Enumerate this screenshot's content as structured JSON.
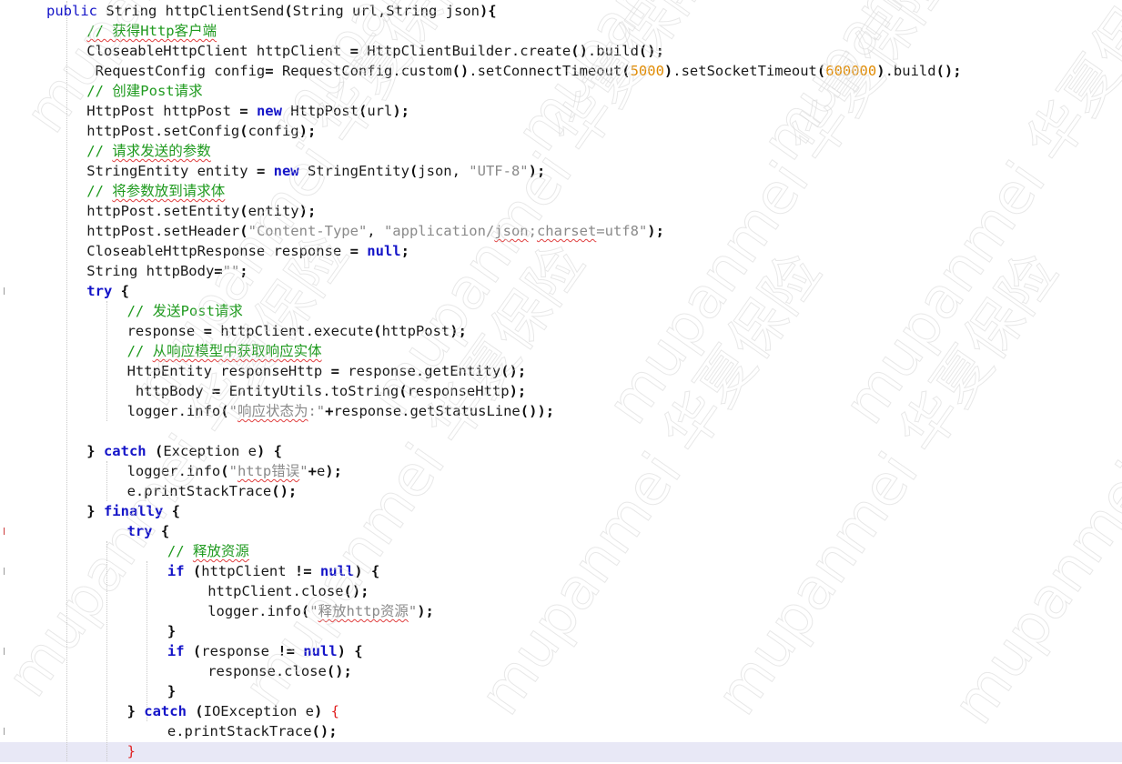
{
  "editor": {
    "watermark": "mupanmei 华夏保险",
    "gutter_marks": [
      {
        "line": 14,
        "kind": "normal"
      },
      {
        "line": 26,
        "kind": "error"
      },
      {
        "line": 28,
        "kind": "normal"
      },
      {
        "line": 32,
        "kind": "normal"
      },
      {
        "line": 36,
        "kind": "normal"
      }
    ],
    "lines": [
      {
        "indent": 1,
        "tokens": [
          {
            "t": "public",
            "c": "kwl"
          },
          {
            "t": " String httpClientSend",
            "c": "tx"
          },
          {
            "t": "(",
            "c": "pn"
          },
          {
            "t": "String url,String json",
            "c": "tx"
          },
          {
            "t": "){",
            "c": "pn"
          }
        ]
      },
      {
        "indent": 2,
        "tokens": [
          {
            "t": "// 获得Http客户端",
            "c": "cm",
            "sq": true
          }
        ]
      },
      {
        "indent": 2,
        "tokens": [
          {
            "t": "CloseableHttpClient httpClient ",
            "c": "tx"
          },
          {
            "t": "=",
            "c": "pn"
          },
          {
            "t": " HttpClientBuilder.create",
            "c": "tx"
          },
          {
            "t": "()",
            "c": "pn"
          },
          {
            "t": ".build",
            "c": "tx"
          },
          {
            "t": "();",
            "c": "pn"
          }
        ]
      },
      {
        "indent": 2,
        "tokens": [
          {
            "t": " RequestConfig config",
            "c": "tx"
          },
          {
            "t": "=",
            "c": "pn"
          },
          {
            "t": " RequestConfig.custom",
            "c": "tx"
          },
          {
            "t": "()",
            "c": "pn"
          },
          {
            "t": ".setConnectTimeout",
            "c": "tx"
          },
          {
            "t": "(",
            "c": "pn"
          },
          {
            "t": "5000",
            "c": "nm"
          },
          {
            "t": ")",
            "c": "pn"
          },
          {
            "t": ".setSocketTimeout",
            "c": "tx"
          },
          {
            "t": "(",
            "c": "pn"
          },
          {
            "t": "600000",
            "c": "nm"
          },
          {
            "t": ")",
            "c": "pn"
          },
          {
            "t": ".build",
            "c": "tx"
          },
          {
            "t": "();",
            "c": "pn"
          }
        ]
      },
      {
        "indent": 2,
        "tokens": [
          {
            "t": "// 创建Post请求",
            "c": "cm"
          }
        ]
      },
      {
        "indent": 2,
        "tokens": [
          {
            "t": "HttpPost httpPost ",
            "c": "tx"
          },
          {
            "t": "=",
            "c": "pn"
          },
          {
            "t": " ",
            "c": "tx"
          },
          {
            "t": "new",
            "c": "kw"
          },
          {
            "t": " HttpPost",
            "c": "tx"
          },
          {
            "t": "(",
            "c": "pn"
          },
          {
            "t": "url",
            "c": "tx"
          },
          {
            "t": ");",
            "c": "pn"
          }
        ]
      },
      {
        "indent": 2,
        "tokens": [
          {
            "t": "httpPost.setConfig",
            "c": "tx"
          },
          {
            "t": "(",
            "c": "pn"
          },
          {
            "t": "config",
            "c": "tx"
          },
          {
            "t": ");",
            "c": "pn"
          }
        ]
      },
      {
        "indent": 2,
        "tokens": [
          {
            "t": "// ",
            "c": "cm"
          },
          {
            "t": "请求发送的参数",
            "c": "cm",
            "sq": true
          }
        ]
      },
      {
        "indent": 2,
        "tokens": [
          {
            "t": "StringEntity entity ",
            "c": "tx"
          },
          {
            "t": "=",
            "c": "pn"
          },
          {
            "t": " ",
            "c": "tx"
          },
          {
            "t": "new",
            "c": "kw"
          },
          {
            "t": " StringEntity",
            "c": "tx"
          },
          {
            "t": "(",
            "c": "pn"
          },
          {
            "t": "json, ",
            "c": "tx"
          },
          {
            "t": "\"UTF-8\"",
            "c": "st"
          },
          {
            "t": ");",
            "c": "pn"
          }
        ]
      },
      {
        "indent": 2,
        "tokens": [
          {
            "t": "// ",
            "c": "cm"
          },
          {
            "t": "将参数放到请求体",
            "c": "cm",
            "sq": true
          }
        ]
      },
      {
        "indent": 2,
        "tokens": [
          {
            "t": "httpPost.setEntity",
            "c": "tx"
          },
          {
            "t": "(",
            "c": "pn"
          },
          {
            "t": "entity",
            "c": "tx"
          },
          {
            "t": ");",
            "c": "pn"
          }
        ]
      },
      {
        "indent": 2,
        "tokens": [
          {
            "t": "httpPost.setHeader",
            "c": "tx"
          },
          {
            "t": "(",
            "c": "pn"
          },
          {
            "t": "\"Content-Type\"",
            "c": "st"
          },
          {
            "t": ", ",
            "c": "tx"
          },
          {
            "t": "\"application/",
            "c": "st"
          },
          {
            "t": "json",
            "c": "st",
            "sq": true
          },
          {
            "t": ";",
            "c": "st"
          },
          {
            "t": "charset",
            "c": "st",
            "sq": true
          },
          {
            "t": "=utf8\"",
            "c": "st"
          },
          {
            "t": ");",
            "c": "pn"
          }
        ]
      },
      {
        "indent": 2,
        "tokens": [
          {
            "t": "CloseableHttpResponse response ",
            "c": "tx"
          },
          {
            "t": "=",
            "c": "pn"
          },
          {
            "t": " ",
            "c": "tx"
          },
          {
            "t": "null",
            "c": "kw"
          },
          {
            "t": ";",
            "c": "pn"
          }
        ]
      },
      {
        "indent": 2,
        "tokens": [
          {
            "t": "String httpBody",
            "c": "tx"
          },
          {
            "t": "=",
            "c": "pn"
          },
          {
            "t": "\"\"",
            "c": "st"
          },
          {
            "t": ";",
            "c": "pn"
          }
        ]
      },
      {
        "indent": 2,
        "tokens": [
          {
            "t": "try",
            "c": "kw"
          },
          {
            "t": " {",
            "c": "pn"
          }
        ]
      },
      {
        "indent": 3,
        "tokens": [
          {
            "t": "// 发送Post请求",
            "c": "cm"
          }
        ]
      },
      {
        "indent": 3,
        "tokens": [
          {
            "t": "response ",
            "c": "tx"
          },
          {
            "t": "=",
            "c": "pn"
          },
          {
            "t": " httpClient.execute",
            "c": "tx"
          },
          {
            "t": "(",
            "c": "pn"
          },
          {
            "t": "httpPost",
            "c": "tx"
          },
          {
            "t": ");",
            "c": "pn"
          }
        ]
      },
      {
        "indent": 3,
        "tokens": [
          {
            "t": "// ",
            "c": "cm"
          },
          {
            "t": "从响应模型中获取响应实体",
            "c": "cm",
            "sq": true
          }
        ]
      },
      {
        "indent": 3,
        "tokens": [
          {
            "t": "HttpEntity responseHttp ",
            "c": "tx"
          },
          {
            "t": "=",
            "c": "pn"
          },
          {
            "t": " response.getEntity",
            "c": "tx"
          },
          {
            "t": "();",
            "c": "pn"
          }
        ]
      },
      {
        "indent": 3,
        "tokens": [
          {
            "t": " httpBody ",
            "c": "tx"
          },
          {
            "t": "=",
            "c": "pn"
          },
          {
            "t": " EntityUtils.toString",
            "c": "tx"
          },
          {
            "t": "(",
            "c": "pn"
          },
          {
            "t": "responseHttp",
            "c": "tx"
          },
          {
            "t": ");",
            "c": "pn"
          }
        ]
      },
      {
        "indent": 3,
        "tokens": [
          {
            "t": "logger.info",
            "c": "tx"
          },
          {
            "t": "(",
            "c": "pn"
          },
          {
            "t": "\"",
            "c": "st"
          },
          {
            "t": "响应状态为",
            "c": "st",
            "sq": true
          },
          {
            "t": ":\"",
            "c": "st"
          },
          {
            "t": "+",
            "c": "pn"
          },
          {
            "t": "response.getStatusLine",
            "c": "tx"
          },
          {
            "t": "());",
            "c": "pn"
          }
        ]
      },
      {
        "indent": 0,
        "tokens": []
      },
      {
        "indent": 2,
        "tokens": [
          {
            "t": "} ",
            "c": "pn"
          },
          {
            "t": "catch",
            "c": "kw"
          },
          {
            "t": " ",
            "c": "tx"
          },
          {
            "t": "(",
            "c": "pn"
          },
          {
            "t": "Exception e",
            "c": "tx"
          },
          {
            "t": ")",
            "c": "pn"
          },
          {
            "t": " {",
            "c": "pn"
          }
        ]
      },
      {
        "indent": 3,
        "tokens": [
          {
            "t": "logger.info",
            "c": "tx"
          },
          {
            "t": "(",
            "c": "pn"
          },
          {
            "t": "\"",
            "c": "st"
          },
          {
            "t": "http错误",
            "c": "st",
            "sq": true
          },
          {
            "t": "\"",
            "c": "st"
          },
          {
            "t": "+",
            "c": "pn"
          },
          {
            "t": "e",
            "c": "tx"
          },
          {
            "t": ");",
            "c": "pn"
          }
        ]
      },
      {
        "indent": 3,
        "tokens": [
          {
            "t": "e.printStackTrace",
            "c": "tx"
          },
          {
            "t": "();",
            "c": "pn"
          }
        ]
      },
      {
        "indent": 2,
        "tokens": [
          {
            "t": "} ",
            "c": "pn"
          },
          {
            "t": "finally",
            "c": "kw"
          },
          {
            "t": " {",
            "c": "pn"
          }
        ]
      },
      {
        "indent": 3,
        "tokens": [
          {
            "t": "try",
            "c": "kw"
          },
          {
            "t": " {",
            "c": "pn"
          }
        ]
      },
      {
        "indent": 4,
        "tokens": [
          {
            "t": "// ",
            "c": "cm"
          },
          {
            "t": "释放资源",
            "c": "cm",
            "sq": true
          }
        ]
      },
      {
        "indent": 4,
        "tokens": [
          {
            "t": "if",
            "c": "kw"
          },
          {
            "t": " ",
            "c": "tx"
          },
          {
            "t": "(",
            "c": "pn"
          },
          {
            "t": "httpClient ",
            "c": "tx"
          },
          {
            "t": "!=",
            "c": "pn"
          },
          {
            "t": " ",
            "c": "tx"
          },
          {
            "t": "null",
            "c": "kw"
          },
          {
            "t": ")",
            "c": "pn"
          },
          {
            "t": " {",
            "c": "pn"
          }
        ]
      },
      {
        "indent": 5,
        "tokens": [
          {
            "t": "httpClient.close",
            "c": "tx"
          },
          {
            "t": "();",
            "c": "pn"
          }
        ]
      },
      {
        "indent": 5,
        "tokens": [
          {
            "t": "logger.info",
            "c": "tx"
          },
          {
            "t": "(",
            "c": "pn"
          },
          {
            "t": "\"",
            "c": "st"
          },
          {
            "t": "释放http资源",
            "c": "st",
            "sq": true
          },
          {
            "t": "\"",
            "c": "st"
          },
          {
            "t": ");",
            "c": "pn"
          }
        ]
      },
      {
        "indent": 4,
        "tokens": [
          {
            "t": "}",
            "c": "pn"
          }
        ]
      },
      {
        "indent": 4,
        "tokens": [
          {
            "t": "if",
            "c": "kw"
          },
          {
            "t": " ",
            "c": "tx"
          },
          {
            "t": "(",
            "c": "pn"
          },
          {
            "t": "response ",
            "c": "tx"
          },
          {
            "t": "!=",
            "c": "pn"
          },
          {
            "t": " ",
            "c": "tx"
          },
          {
            "t": "null",
            "c": "kw"
          },
          {
            "t": ")",
            "c": "pn"
          },
          {
            "t": " {",
            "c": "pn"
          }
        ]
      },
      {
        "indent": 5,
        "tokens": [
          {
            "t": "response.close",
            "c": "tx"
          },
          {
            "t": "();",
            "c": "pn"
          }
        ]
      },
      {
        "indent": 4,
        "tokens": [
          {
            "t": "}",
            "c": "pn"
          }
        ]
      },
      {
        "indent": 3,
        "tokens": [
          {
            "t": "} ",
            "c": "pn"
          },
          {
            "t": "catch",
            "c": "kw"
          },
          {
            "t": " ",
            "c": "tx"
          },
          {
            "t": "(",
            "c": "pn"
          },
          {
            "t": "IOException e",
            "c": "tx"
          },
          {
            "t": ")",
            "c": "pn"
          },
          {
            "t": " {",
            "c": "er"
          }
        ]
      },
      {
        "indent": 4,
        "tokens": [
          {
            "t": "e.printStackTrace",
            "c": "tx"
          },
          {
            "t": "();",
            "c": "pn"
          }
        ]
      },
      {
        "indent": 3,
        "tokens": [
          {
            "t": "}",
            "c": "er"
          }
        ]
      }
    ]
  }
}
